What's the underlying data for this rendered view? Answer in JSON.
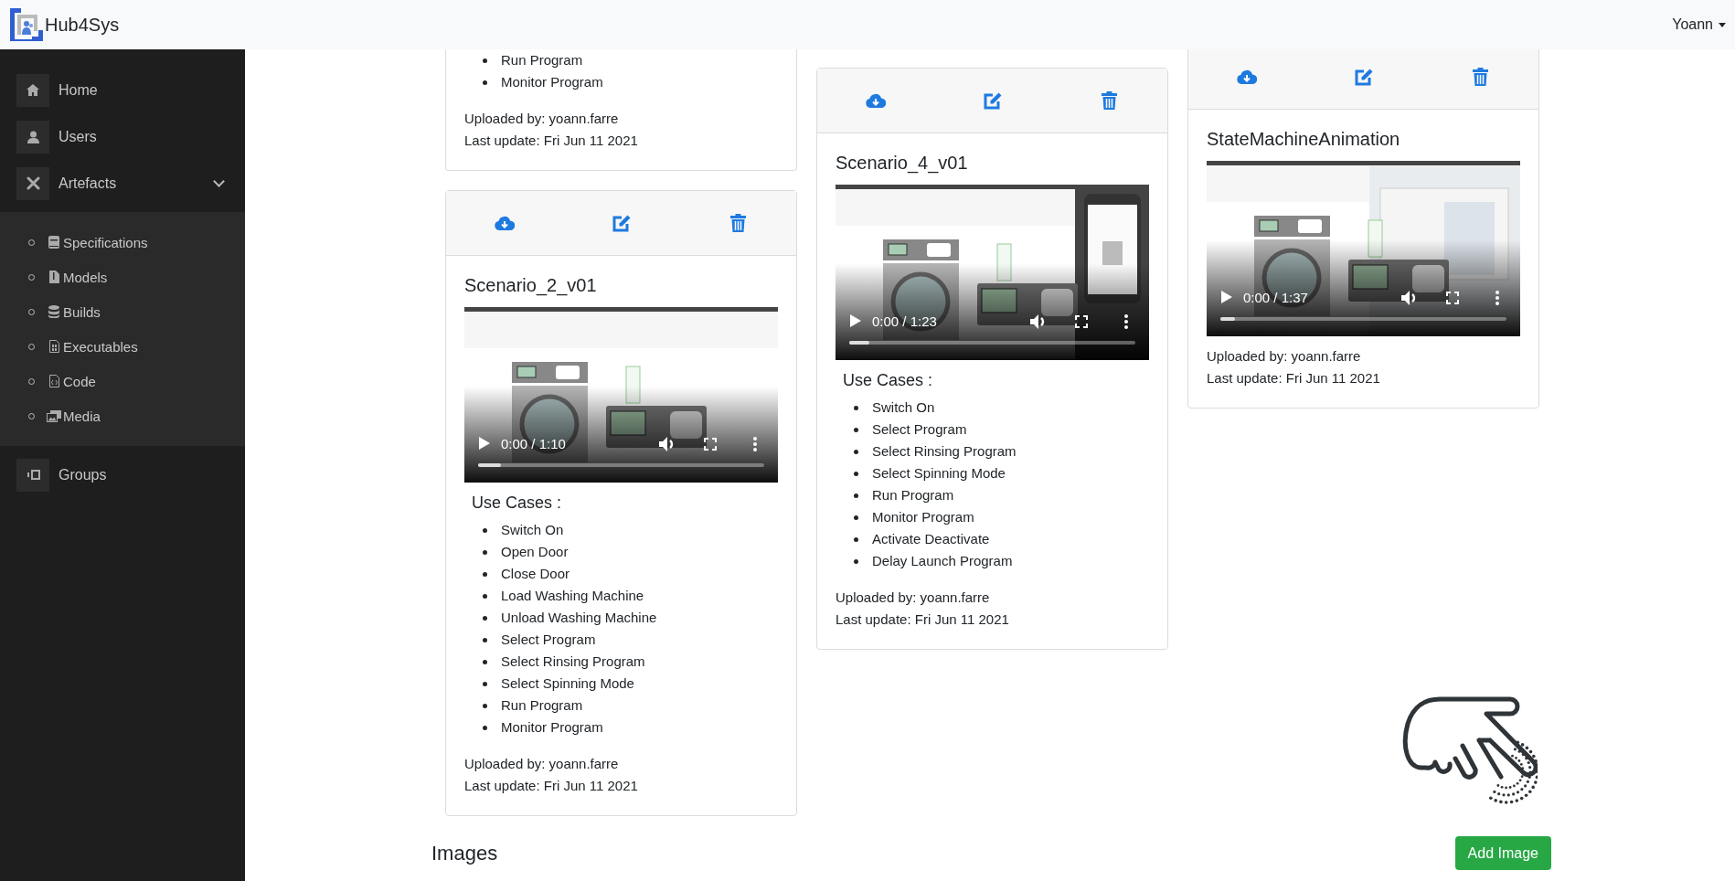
{
  "navbar": {
    "brand": "Hub4Sys",
    "user": "Yoann"
  },
  "sidebar": {
    "items": [
      {
        "label": "Home"
      },
      {
        "label": "Users"
      },
      {
        "label": "Artefacts",
        "expanded": true,
        "children": [
          {
            "label": "Specifications"
          },
          {
            "label": "Models"
          },
          {
            "label": "Builds"
          },
          {
            "label": "Executables"
          },
          {
            "label": "Code"
          },
          {
            "label": "Media"
          }
        ]
      },
      {
        "label": "Groups"
      }
    ]
  },
  "columns": [
    {
      "cards": [
        {
          "toolbar": false,
          "use_cases": [
            "Run Program",
            "Monitor Program"
          ],
          "uploaded_by": "Uploaded by: yoann.farre",
          "last_update": "Last update: Fri Jun 11 2021"
        },
        {
          "toolbar": true,
          "title": "Scenario_2_v01",
          "video": {
            "time": "0:00 / 1:10",
            "level": 0.08
          },
          "use_cases_heading": "Use Cases :",
          "use_cases": [
            "Switch On",
            "Open Door",
            "Close Door",
            "Load Washing Machine",
            "Unload Washing Machine",
            "Select Program",
            "Select Rinsing Program",
            "Select Spinning Mode",
            "Run Program",
            "Monitor Program"
          ],
          "uploaded_by": "Uploaded by: yoann.farre",
          "last_update": "Last update: Fri Jun 11 2021"
        }
      ]
    },
    {
      "cards": [
        {
          "toolbar": true,
          "title": "Scenario_4_v01",
          "video": {
            "time": "0:00 / 1:23",
            "level": 0.07
          },
          "use_cases_heading": "Use Cases :",
          "use_cases": [
            "Switch On",
            "Select Program",
            "Select Rinsing Program",
            "Select Spinning Mode",
            "Run Program",
            "Monitor Program",
            "Activate Deactivate",
            "Delay Launch Program"
          ],
          "uploaded_by": "Uploaded by: yoann.farre",
          "last_update": "Last update: Fri Jun 11 2021"
        }
      ]
    },
    {
      "cards": [
        {
          "toolbar": true,
          "title": "StateMachineAnimation",
          "video": {
            "time": "0:00 / 1:37",
            "level": 0.05
          },
          "uploaded_by": "Uploaded by: yoann.farre",
          "last_update": "Last update: Fri Jun 11 2021"
        }
      ]
    }
  ],
  "images_section": {
    "heading": "Images",
    "button": "Add Image"
  }
}
